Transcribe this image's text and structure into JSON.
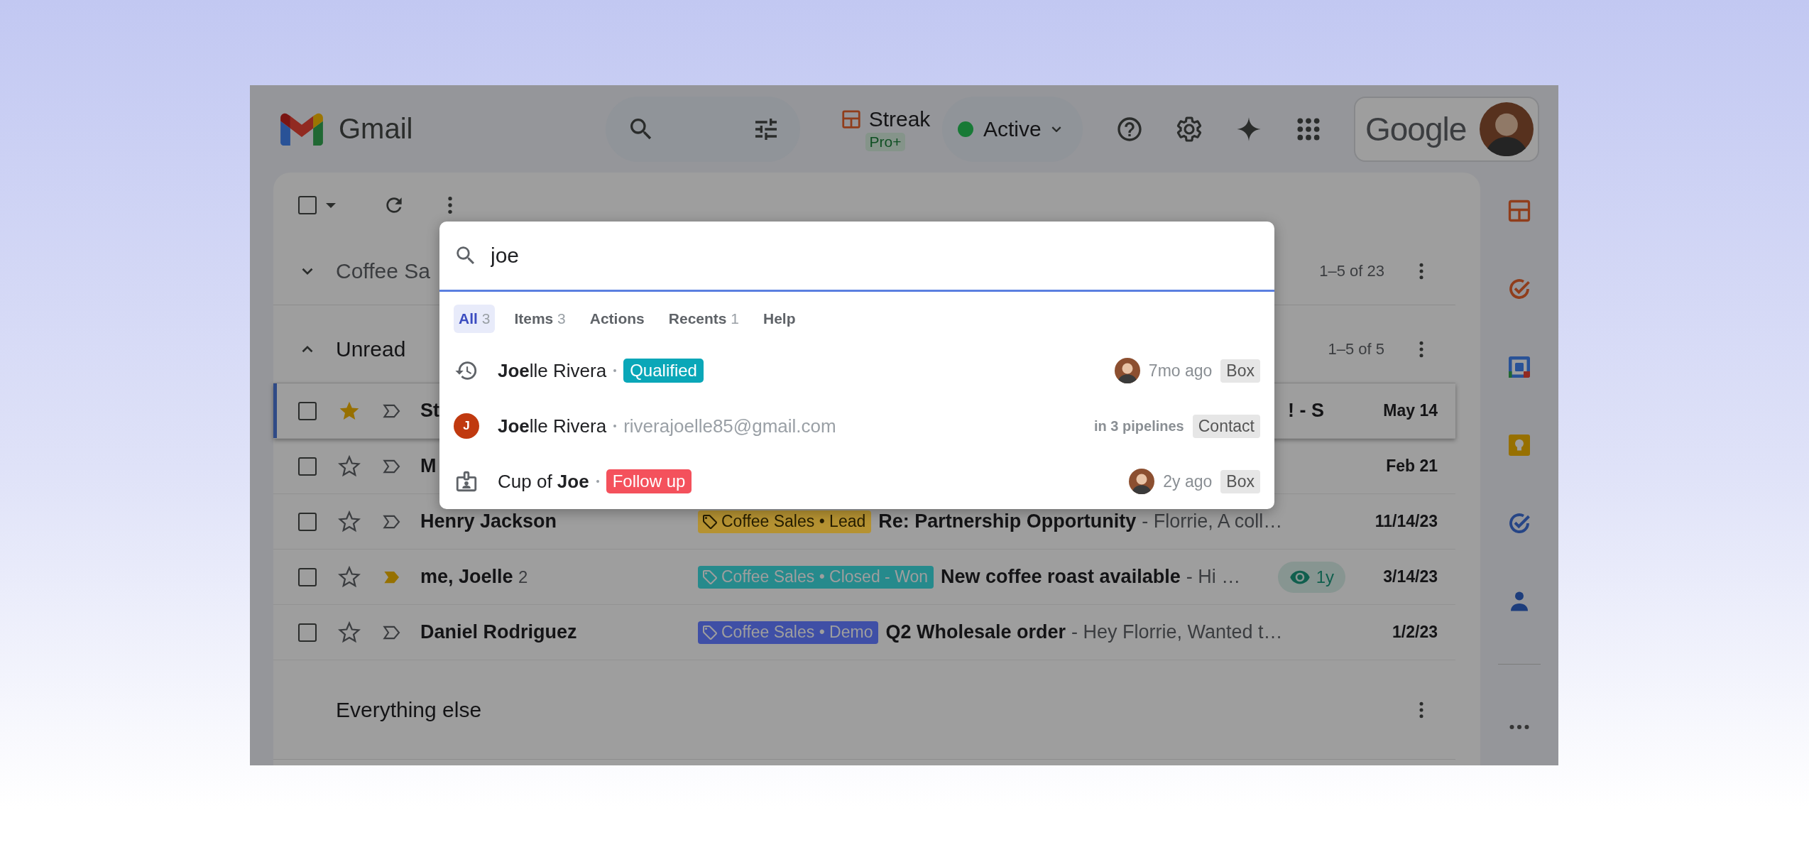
{
  "header": {
    "app_name": "Gmail",
    "streak": {
      "label": "Streak",
      "plan": "Pro+"
    },
    "status": {
      "label": "Active",
      "color": "#187a36"
    },
    "account": {
      "label": "Google"
    }
  },
  "toolbar": {
    "select_all_checked": false
  },
  "sections": [
    {
      "title": "Coffee Sa",
      "expanded": false,
      "count": "1–5 of 23"
    },
    {
      "title": "Unread",
      "expanded": true,
      "count": "1–5 of 5"
    }
  ],
  "rows": [
    {
      "sender": "St",
      "checked": false,
      "starred": true,
      "important": false,
      "focused": true,
      "tail": "! - S",
      "date": "May 14"
    },
    {
      "sender": "M",
      "checked": false,
      "starred": false,
      "important": false,
      "focused": false,
      "date": "Feb 21"
    },
    {
      "sender": "Henry Jackson",
      "checked": false,
      "starred": false,
      "important": false,
      "focused": false,
      "label": {
        "text": "Coffee Sales • Lead",
        "color": "#b59232"
      },
      "subject": "Re: Partnership Opportunity",
      "snippet": "- Florrie, A coll…",
      "date": "11/14/23"
    },
    {
      "sender": "me, Joelle",
      "thread_count": "2",
      "checked": false,
      "starred": false,
      "important": true,
      "focused": false,
      "label": {
        "text": "Coffee Sales • Closed - Won",
        "color": "#268a8c"
      },
      "subject": "New coffee roast available",
      "snippet": "- Hi …",
      "seen": "1y",
      "date": "3/14/23"
    },
    {
      "sender": "Daniel Rodriguez",
      "checked": false,
      "starred": false,
      "important": false,
      "focused": false,
      "label": {
        "text": "Coffee Sales • Demo",
        "color": "#3f4fa6"
      },
      "subject": "Q2 Wholesale order",
      "snippet": "- Hey Florrie, Wanted t…",
      "date": "1/2/23"
    }
  ],
  "other_section": {
    "title": "Everything else"
  },
  "command_palette": {
    "query": "joe",
    "tabs": [
      {
        "label": "All",
        "count": "3",
        "selected": true
      },
      {
        "label": "Items",
        "count": "3",
        "selected": false
      },
      {
        "label": "Actions",
        "selected": false
      },
      {
        "label": "Recents",
        "count": "1",
        "selected": false
      },
      {
        "label": "Help",
        "selected": false
      }
    ],
    "results": [
      {
        "kind": "recent",
        "title": "**Joe**lle Rivera",
        "tag": {
          "text": "Qualified",
          "color": "#0aa7b8"
        },
        "avatar": true,
        "meta": "7mo ago",
        "type": "Box"
      },
      {
        "kind": "contact",
        "initial": "J",
        "title": "**Joe**lle Rivera",
        "subtitle": "riverajoelle85@gmail.com",
        "meta": "in 3 pipelines",
        "type": "Contact"
      },
      {
        "kind": "box",
        "title": "Cup of **Joe**",
        "tag": {
          "text": "Follow up",
          "color": "#f4515c"
        },
        "avatar": true,
        "meta": "2y ago",
        "type": "Box"
      }
    ]
  }
}
